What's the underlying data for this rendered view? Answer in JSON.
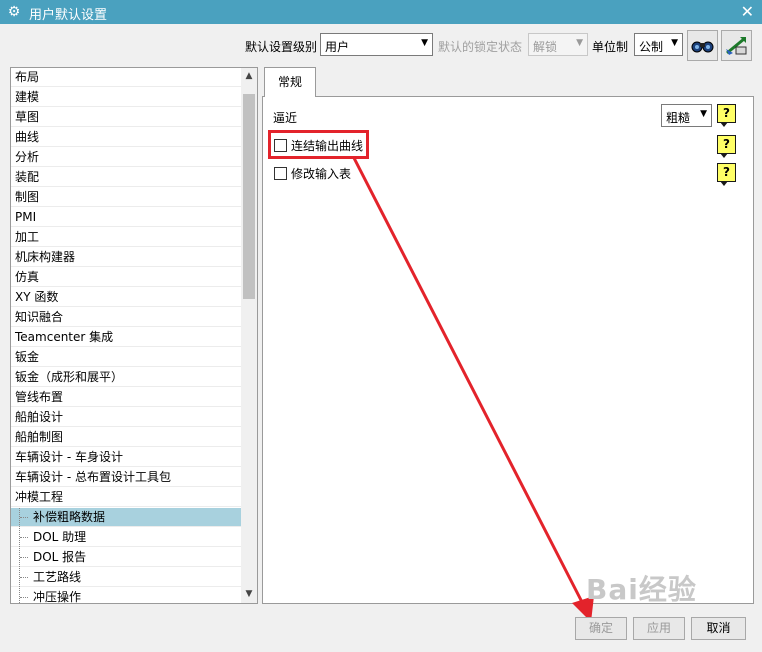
{
  "window": {
    "title": "用户默认设置",
    "close_glyph": "✕"
  },
  "toolbar": {
    "level_label": "默认设置级别",
    "level_value": "用户",
    "lock_label": "默认的锁定状态",
    "lock_value": "解锁",
    "unit_label": "单位制",
    "unit_value": "公制",
    "icons": [
      "search-binoculars-icon",
      "import-export-icon"
    ]
  },
  "tree": {
    "items": [
      {
        "label": "布局"
      },
      {
        "label": "建模"
      },
      {
        "label": "草图"
      },
      {
        "label": "曲线"
      },
      {
        "label": "分析"
      },
      {
        "label": "装配"
      },
      {
        "label": "制图"
      },
      {
        "label": "PMI"
      },
      {
        "label": "加工"
      },
      {
        "label": "机床构建器"
      },
      {
        "label": "仿真"
      },
      {
        "label": "XY 函数"
      },
      {
        "label": "知识融合"
      },
      {
        "label": "Teamcenter 集成"
      },
      {
        "label": "钣金"
      },
      {
        "label": "钣金（成形和展平）"
      },
      {
        "label": "管线布置"
      },
      {
        "label": "船舶设计"
      },
      {
        "label": "船舶制图"
      },
      {
        "label": "车辆设计 - 车身设计"
      },
      {
        "label": "车辆设计 - 总布置设计工具包"
      },
      {
        "label": "冲模工程"
      }
    ],
    "children": [
      {
        "label": "补偿粗略数据",
        "selected": true
      },
      {
        "label": "DOL 助理"
      },
      {
        "label": "DOL 报告"
      },
      {
        "label": "工艺路线"
      },
      {
        "label": "冲压操作"
      }
    ]
  },
  "tab": {
    "label": "常规"
  },
  "panel": {
    "approx_label": "逼近",
    "approx_value": "粗糙",
    "option1_label": "连结输出曲线",
    "option2_label": "修改输入表",
    "help_glyph": "?"
  },
  "buttons": {
    "ok": "确定",
    "apply": "应用",
    "cancel": "取消"
  },
  "watermark": "Bai经验",
  "colors": {
    "titlebar": "#4aa1bf",
    "selected": "#a8d1de",
    "annotation": "#e3232b",
    "help_bg": "#ffff66"
  }
}
